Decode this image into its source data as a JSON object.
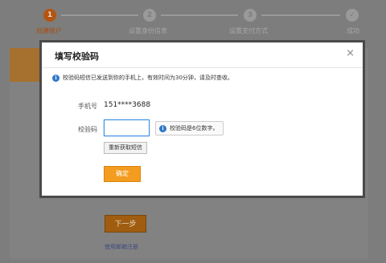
{
  "steps": [
    {
      "number": "1",
      "label": "创建账户"
    },
    {
      "number": "2",
      "label": "设置身份信息"
    },
    {
      "number": "3",
      "label": "设置支付方式"
    },
    {
      "number": "✓",
      "label": "成功"
    }
  ],
  "background": {
    "next_button": "下一步",
    "email_link": "使用邮箱注册"
  },
  "dialog": {
    "title": "填写校验码",
    "close": "×",
    "notice": "校验码短信已发送到你的手机上，有效时间为30分钟，请及时查收。",
    "phone_label": "手机号",
    "phone_value": "151****3688",
    "code_label": "校验码",
    "code_value": "",
    "code_tip": "校验码是6位数字。",
    "resend_button": "重新获取短信",
    "confirm_button": "确定"
  },
  "colors": {
    "accent": "#f39c1f",
    "info": "#2e78c8",
    "input_focus": "#3a8ee6"
  }
}
